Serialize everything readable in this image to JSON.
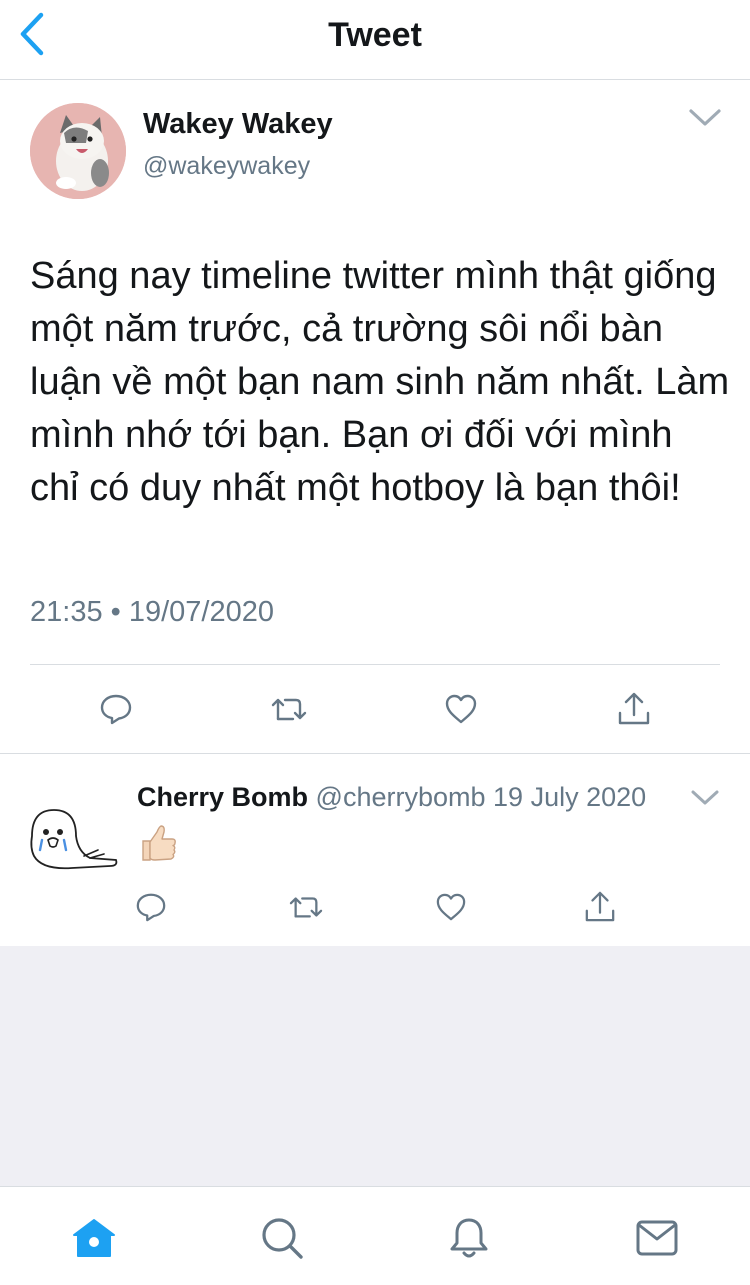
{
  "header": {
    "title": "Tweet",
    "back_icon": "chevron-left-icon"
  },
  "main_tweet": {
    "author_name": "Wakey Wakey",
    "author_handle": "@wakeywakey",
    "text": "Sáng nay timeline twitter mình thật giống một năm trước, cả trường sôi nổi bàn luận về một bạn nam sinh năm nhất. Làm mình nhớ tới bạn. Bạn ơi đối với mình chỉ có duy nhất một hotboy là bạn thôi!",
    "timestamp": "21:35 • 19/07/2020",
    "actions": [
      "reply-icon",
      "retweet-icon",
      "like-icon",
      "share-icon"
    ]
  },
  "reply": {
    "author_name": "Cherry Bomb",
    "author_handle": "@cherrybomb",
    "date": "19 July 2020",
    "content": "👍🏻",
    "actions": [
      "reply-icon",
      "retweet-icon",
      "like-icon",
      "share-icon"
    ]
  },
  "tabbar": {
    "items": [
      "home-icon",
      "search-icon",
      "notifications-icon",
      "messages-icon"
    ],
    "active": "home-icon"
  },
  "colors": {
    "accent": "#1da1f2",
    "icon_gray": "#657786",
    "divider": "#d9dde1",
    "background_empty": "#efeff4",
    "text_primary": "#14171a"
  }
}
